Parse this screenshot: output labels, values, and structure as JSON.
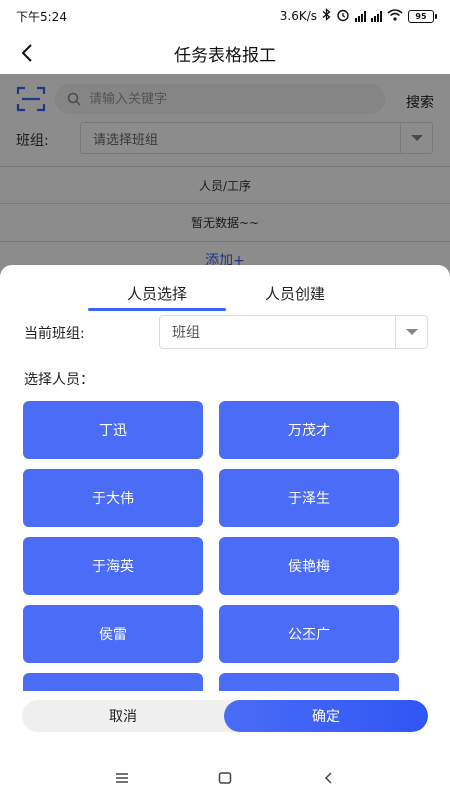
{
  "status_bar": {
    "time": "下午5:24",
    "network_speed": "3.6K/s",
    "battery": "95"
  },
  "header": {
    "title": "任务表格报工"
  },
  "background": {
    "search_placeholder": "请输入关键字",
    "search_button": "搜索",
    "team_label": "班组:",
    "team_placeholder": "请选择班组",
    "table_header": "人员/工序",
    "empty_text": "暂无数据~~",
    "add_link": "添加+"
  },
  "sheet": {
    "tabs": [
      {
        "label": "人员选择",
        "active": true
      },
      {
        "label": "人员创建",
        "active": false
      }
    ],
    "current_team_label": "当前班组:",
    "current_team_value": "班组",
    "choose_label": "选择人员：",
    "persons": [
      "丁迅",
      "万茂才",
      "于大伟",
      "于泽生",
      "于海英",
      "侯艳梅",
      "侯雷",
      "公丕广",
      "",
      ""
    ],
    "cancel_label": "取消",
    "confirm_label": "确定"
  },
  "colors": {
    "accent": "#4a6cf7",
    "overlay": "rgba(0,0,0,0.45)"
  }
}
